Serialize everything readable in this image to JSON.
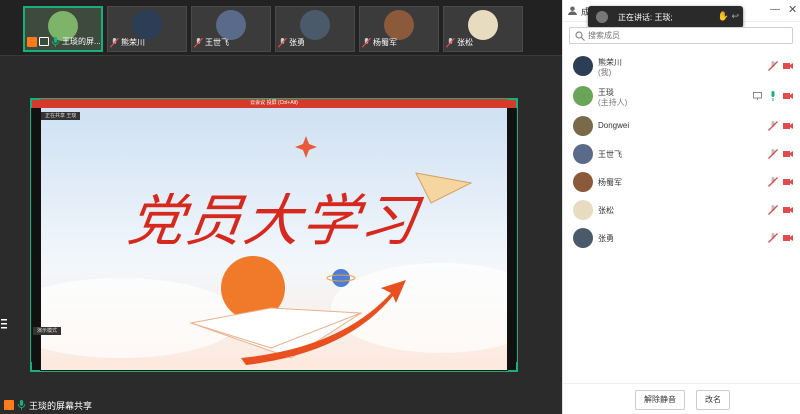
{
  "thumbnails": [
    {
      "name": "王琰的屏...",
      "active": true
    },
    {
      "name": "熊荣川",
      "active": false
    },
    {
      "name": "王世飞",
      "active": false
    },
    {
      "name": "张勇",
      "active": false
    },
    {
      "name": "杨蜀军",
      "active": false
    },
    {
      "name": "张松",
      "active": false
    }
  ],
  "stage": {
    "presenter_bar": "云会议 投屏 (Ctrl+Alt)",
    "slide_title": "党员大学习",
    "mini_tag_top": "正在共享 王琰",
    "mini_tag_bottom": "演示模式",
    "screen_share_label": "王琰的屏幕共享"
  },
  "panel": {
    "title": "成员",
    "speaking_label": "正在讲话: 王琰;",
    "search_placeholder": "搜索成员",
    "members": [
      {
        "name": "熊荣川",
        "role": "(我)",
        "avatar": "#2c3e55"
      },
      {
        "name": "王琰",
        "role": "(主持人)",
        "avatar": "#6aa65a"
      },
      {
        "name": "Dongwei",
        "role": "",
        "avatar": "#7a6a4a"
      },
      {
        "name": "王世飞",
        "role": "",
        "avatar": "#5a6a8a"
      },
      {
        "name": "杨蜀军",
        "role": "",
        "avatar": "#8a5a3a"
      },
      {
        "name": "张松",
        "role": "",
        "avatar": "#e8dcc0"
      },
      {
        "name": "张勇",
        "role": "",
        "avatar": "#4a5a6a"
      }
    ],
    "footer": {
      "unmute_all": "解除静音",
      "rename": "改名"
    }
  },
  "colors": {
    "accent_green": "#16b07a",
    "mute_red": "#e04b4b",
    "presenter_red": "#d63a2c"
  }
}
